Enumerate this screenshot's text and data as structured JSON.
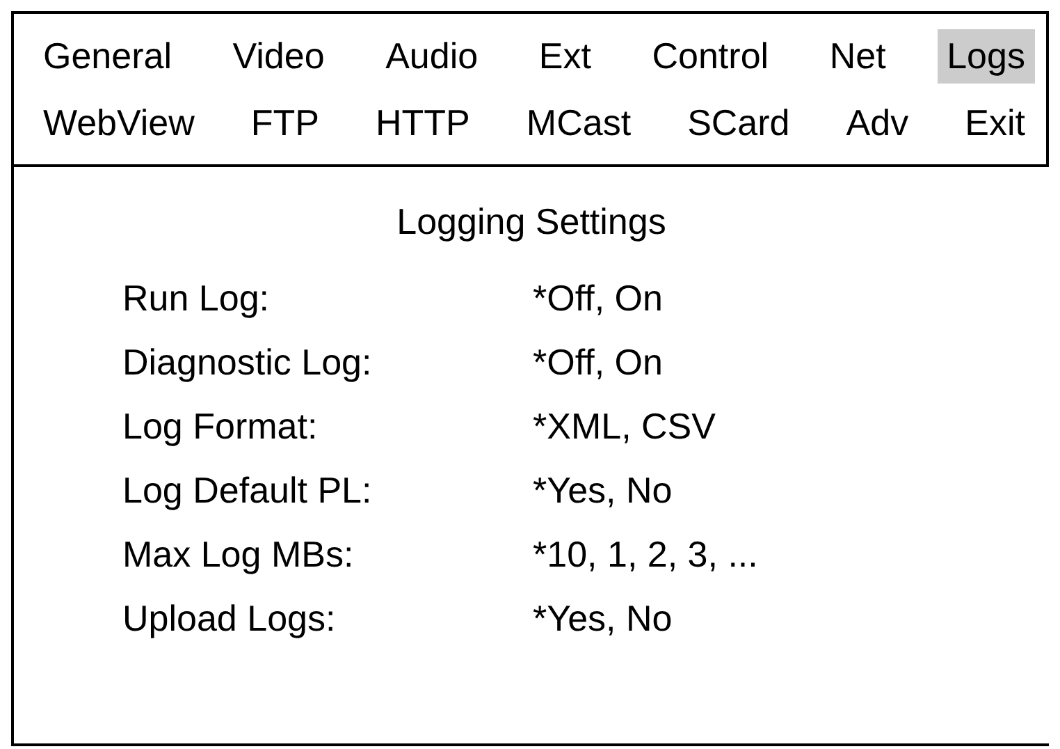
{
  "tab_rows": [
    [
      {
        "label": "General",
        "selected": false
      },
      {
        "label": "Video",
        "selected": false
      },
      {
        "label": "Audio",
        "selected": false
      },
      {
        "label": "Ext",
        "selected": false
      },
      {
        "label": "Control",
        "selected": false
      },
      {
        "label": "Net",
        "selected": false
      },
      {
        "label": "Logs",
        "selected": true
      }
    ],
    [
      {
        "label": "WebView",
        "selected": false
      },
      {
        "label": "FTP",
        "selected": false
      },
      {
        "label": "HTTP",
        "selected": false
      },
      {
        "label": "MCast",
        "selected": false
      },
      {
        "label": "SCard",
        "selected": false
      },
      {
        "label": "Adv",
        "selected": false
      },
      {
        "label": "Exit",
        "selected": false
      }
    ]
  ],
  "title": "Logging Settings",
  "settings": [
    {
      "label": "Run Log:",
      "value": "*Off, On"
    },
    {
      "label": "Diagnostic Log:",
      "value": "*Off, On"
    },
    {
      "label": "Log Format:",
      "value": "*XML, CSV"
    },
    {
      "label": "Log Default PL:",
      "value": "*Yes, No"
    },
    {
      "label": "Max Log MBs:",
      "value": "*10, 1, 2, 3, ..."
    },
    {
      "label": "Upload Logs:",
      "value": "*Yes, No"
    }
  ]
}
